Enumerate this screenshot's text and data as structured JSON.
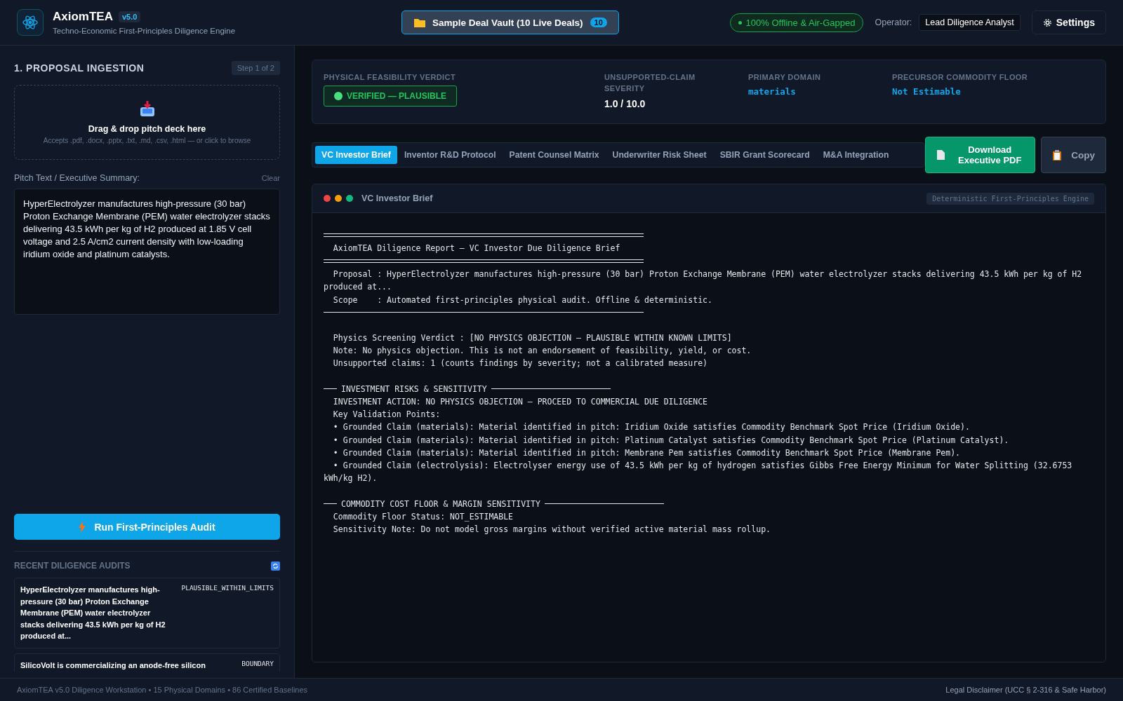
{
  "header": {
    "app_name": "AxiomTEA",
    "version": "v5.0",
    "tagline": "Techno-Economic First-Principles Diligence Engine",
    "vault_button": {
      "label": "Sample Deal Vault (10 Live Deals)",
      "count": "10"
    },
    "status_pill": "100% Offline & Air-Gapped",
    "operator_label": "Operator:",
    "operator_value": "Lead Diligence Analyst",
    "settings_button": "Settings"
  },
  "left_panel": {
    "title": "1. PROPOSAL INGESTION",
    "step": "Step 1 of 2",
    "dropzone": {
      "title": "Drag & drop pitch deck here",
      "hint": "Accepts .pdf, .docx, .pptx, .txt, .md, .csv, .html — or click to browse"
    },
    "pitch_label": "Pitch Text / Executive Summary:",
    "clear_link": "Clear",
    "pitch_text": "HyperElectrolyzer manufactures high-pressure (30 bar) Proton Exchange Membrane (PEM) water electrolyzer stacks delivering 43.5 kWh per kg of H2 produced at 1.85 V cell voltage and 2.5 A/cm2 current density with low-loading iridium oxide and platinum catalysts.",
    "run_button": "Run First-Principles Audit",
    "recent_title": "RECENT DILIGENCE AUDITS",
    "recent": [
      {
        "text": "HyperElectrolyzer manufactures high-pressure (30 bar) Proton Exchange Membrane (PEM) water electrolyzer stacks delivering 43.5 kWh per kg of H2 produced at...",
        "status": "PLAUSIBLE_WITHIN_LIMITS"
      },
      {
        "text": "SilicoVolt is commercializing an anode-free silicon",
        "status": "BOUNDARY"
      }
    ]
  },
  "summary": {
    "verdict_label": "PHYSICAL FEASIBILITY VERDICT",
    "verdict": "VERIFIED — PLAUSIBLE",
    "severity_label": "UNSUPPORTED-CLAIM SEVERITY",
    "severity": "1.0 / 10.0",
    "domain_label": "PRIMARY DOMAIN",
    "domain": "materials",
    "floor_label": "PRECURSOR COMMODITY FLOOR",
    "floor": "Not Estimable"
  },
  "tabs": [
    {
      "label": "VC Investor Brief",
      "selected": true
    },
    {
      "label": "Inventor R&D Protocol",
      "selected": false
    },
    {
      "label": "Patent Counsel Matrix",
      "selected": false
    },
    {
      "label": "Underwriter Risk Sheet",
      "selected": false
    },
    {
      "label": "SBIR Grant Scorecard",
      "selected": false
    },
    {
      "label": "M&A Integration",
      "selected": false
    }
  ],
  "download_button": "Download Executive PDF",
  "copy_button": "Copy",
  "report": {
    "title": "VC Investor Brief",
    "engine_tag": "Deterministic First-Principles Engine",
    "lines": [
      {
        "kind": "double-rule"
      },
      {
        "kind": "text",
        "text": "  AxiomTEA Diligence Report — VC Investor Due Diligence Brief"
      },
      {
        "kind": "double-rule"
      },
      {
        "kind": "text",
        "text": "  Proposal : HyperElectrolyzer manufactures high-pressure (30 bar) Proton Exchange Membrane (PEM) water electrolyzer stacks delivering 43.5 kWh per kg of H2 produced at..."
      },
      {
        "kind": "text",
        "text": "  Scope    : Automated first-principles physical audit. Offline & deterministic."
      },
      {
        "kind": "rule"
      },
      {
        "kind": "blank"
      },
      {
        "kind": "text",
        "text": "  Physics Screening Verdict : [NO PHYSICS OBJECTION — PLAUSIBLE WITHIN KNOWN LIMITS]"
      },
      {
        "kind": "text",
        "text": "  Note: No physics objection. This is not an endorsement of feasibility, yield, or cost."
      },
      {
        "kind": "text",
        "text": "  Unsupported claims: 1 (counts findings by severity; not a calibrated measure)"
      },
      {
        "kind": "blank"
      },
      {
        "kind": "section",
        "text": "INVESTMENT RISKS & SENSITIVITY"
      },
      {
        "kind": "text",
        "text": "  INVESTMENT ACTION: NO PHYSICS OBJECTION — PROCEED TO COMMERCIAL DUE DILIGENCE"
      },
      {
        "kind": "text",
        "text": "  Key Validation Points:"
      },
      {
        "kind": "text",
        "text": "  • Grounded Claim (materials): Material identified in pitch: Iridium Oxide satisfies Commodity Benchmark Spot Price (Iridium Oxide)."
      },
      {
        "kind": "text",
        "text": "  • Grounded Claim (materials): Material identified in pitch: Platinum Catalyst satisfies Commodity Benchmark Spot Price (Platinum Catalyst)."
      },
      {
        "kind": "text",
        "text": "  • Grounded Claim (materials): Material identified in pitch: Membrane Pem satisfies Commodity Benchmark Spot Price (Membrane Pem)."
      },
      {
        "kind": "text",
        "text": "  • Grounded Claim (electrolysis): Electrolyser energy use of 43.5 kWh per kg of hydrogen satisfies Gibbs Free Energy Minimum for Water Splitting (32.6753 kWh/kg H2)."
      },
      {
        "kind": "blank"
      },
      {
        "kind": "section",
        "text": "COMMODITY COST FLOOR & MARGIN SENSITIVITY"
      },
      {
        "kind": "text",
        "text": "  Commodity Floor Status: NOT_ESTIMABLE"
      },
      {
        "kind": "text",
        "text": "  Sensitivity Note: Do not model gross margins without verified active material mass rollup."
      }
    ]
  },
  "footer": {
    "left": "AxiomTEA v5.0 Diligence Workstation • 15 Physical Domains • 86 Certified Baselines",
    "right": "Legal Disclaimer (UCC § 2-316 & Safe Harbor)"
  }
}
